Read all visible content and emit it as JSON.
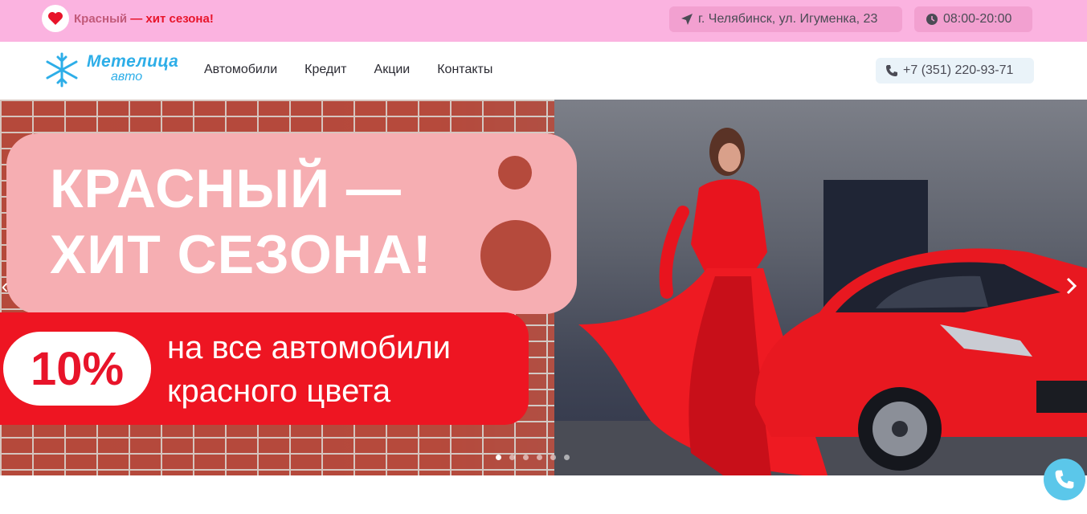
{
  "topbar": {
    "promo_text_1": "Красный",
    "promo_text_2": " — хит сезона!",
    "address": "г. Челябинск, ул. Игуменка, 23",
    "hours": "08:00-20:00"
  },
  "header": {
    "logo_word": "Метелица",
    "logo_sub": "авто",
    "nav": [
      "Автомобили",
      "Кредит",
      "Акции",
      "Контакты"
    ],
    "phone": "+7 (351) 220-93-71"
  },
  "hero": {
    "headline_line1": "КРАСНЫЙ —",
    "headline_line2": "ХИТ СЕЗОНА!",
    "discount": "10%",
    "offer_line1": "на все автомобили",
    "offer_line2": "красного цвета",
    "slide_count": 6,
    "active_slide": 1
  },
  "colors": {
    "topbar_bg": "#fbb3e0",
    "brand_blue": "#2daee8",
    "accent_red": "#e8142a",
    "call_button": "#5bc7ea"
  },
  "icons": {
    "promo": "heart-icon",
    "address": "location-arrow-icon",
    "hours": "clock-icon",
    "phone": "phone-icon",
    "logo": "snowflake-icon",
    "prev": "chevron-left-icon",
    "next": "chevron-right-icon",
    "call": "phone-call-icon"
  }
}
